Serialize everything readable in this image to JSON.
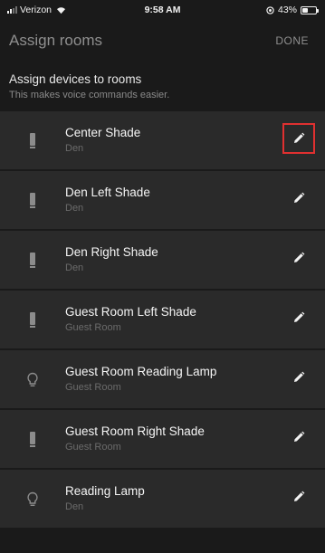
{
  "status_bar": {
    "carrier": "Verizon",
    "time": "9:58 AM",
    "battery_text": "43%",
    "battery_level": 0.43
  },
  "header": {
    "title": "Assign rooms",
    "done_label": "DONE"
  },
  "intro": {
    "title": "Assign devices to rooms",
    "subtitle": "This makes voice commands easier."
  },
  "colors": {
    "background": "#1a1a1a",
    "row_background": "#2a2a2a",
    "highlight": "#e03030"
  },
  "devices": [
    {
      "name": "Center Shade",
      "room": "Den",
      "icon": "shade-icon",
      "highlighted": true
    },
    {
      "name": "Den Left Shade",
      "room": "Den",
      "icon": "shade-icon",
      "highlighted": false
    },
    {
      "name": "Den Right Shade",
      "room": "Den",
      "icon": "shade-icon",
      "highlighted": false
    },
    {
      "name": "Guest Room Left Shade",
      "room": "Guest Room",
      "icon": "shade-icon",
      "highlighted": false
    },
    {
      "name": "Guest Room Reading Lamp",
      "room": "Guest Room",
      "icon": "lightbulb-icon",
      "highlighted": false
    },
    {
      "name": "Guest Room Right Shade",
      "room": "Guest Room",
      "icon": "shade-icon",
      "highlighted": false
    },
    {
      "name": "Reading Lamp",
      "room": "Den",
      "icon": "lightbulb-icon",
      "highlighted": false
    }
  ]
}
